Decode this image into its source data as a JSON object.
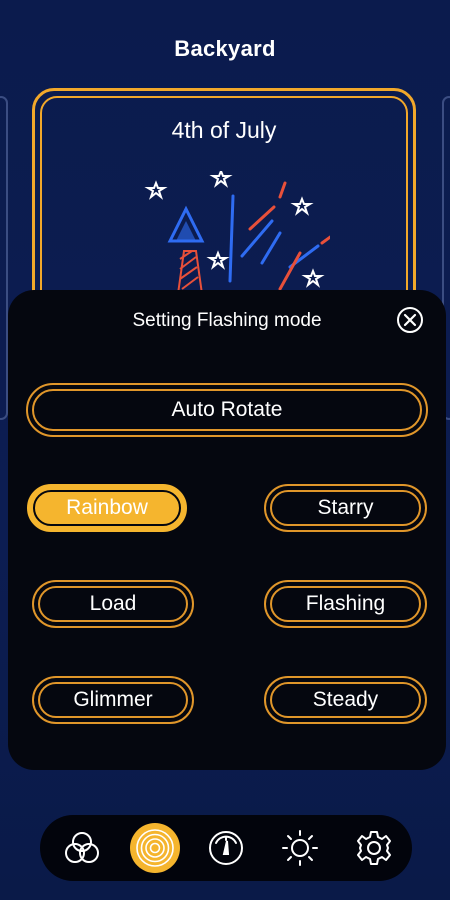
{
  "header": {
    "title": "Backyard"
  },
  "theme_card": {
    "name": "4th of July",
    "illustration": "fireworks-rocket-stars"
  },
  "sheet": {
    "title": "Setting Flashing mode",
    "close_icon": "close-icon",
    "auto_rotate_label": "Auto Rotate",
    "modes": [
      {
        "label": "Rainbow",
        "selected": true
      },
      {
        "label": "Starry",
        "selected": false
      },
      {
        "label": "Load",
        "selected": false
      },
      {
        "label": "Flashing",
        "selected": false
      },
      {
        "label": "Glimmer",
        "selected": false
      },
      {
        "label": "Steady",
        "selected": false
      }
    ]
  },
  "tabbar": {
    "tabs": [
      {
        "icon": "color-circles-icon",
        "active": false
      },
      {
        "icon": "mode-ripple-icon",
        "active": true
      },
      {
        "icon": "speed-gauge-icon",
        "active": false
      },
      {
        "icon": "brightness-sun-icon",
        "active": false
      },
      {
        "icon": "settings-gear-icon",
        "active": false
      }
    ]
  },
  "colors": {
    "accent": "#f5b52e",
    "background": "#0b1b4d",
    "sheet": "#05070f",
    "rocket_red": "#e8503a",
    "rocket_blue": "#2f6cf2"
  }
}
